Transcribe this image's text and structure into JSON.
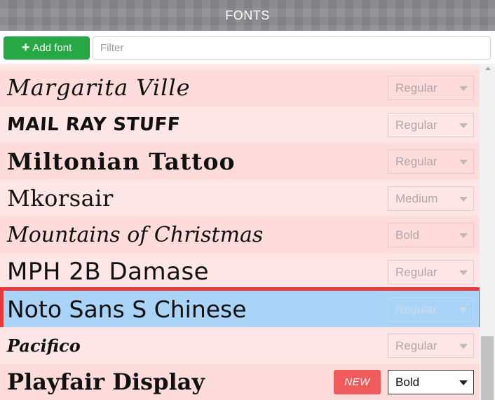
{
  "header": {
    "title": "FONTS"
  },
  "toolbar": {
    "add_label": "Add font",
    "add_icon": "plus-icon",
    "filter_placeholder": "Filter",
    "filter_value": ""
  },
  "fonts": [
    {
      "name": "Margarita Ville",
      "weight": "Regular"
    },
    {
      "name": "MAIL RAY STUFF",
      "weight": "Regular"
    },
    {
      "name": "Miltonian Tattoo",
      "weight": "Regular"
    },
    {
      "name": "Mkorsair",
      "weight": "Medium"
    },
    {
      "name": "Mountains of Christmas",
      "weight": "Bold"
    },
    {
      "name": "MPH 2B Damase",
      "weight": "Regular"
    },
    {
      "name": "Noto Sans S Chinese",
      "weight": "Regular",
      "selected": true
    },
    {
      "name": "Pacifico",
      "weight": "Regular"
    },
    {
      "name": "Playfair Display",
      "weight": "Bold",
      "badge": "NEW"
    }
  ],
  "colors": {
    "accent_green": "#27a844",
    "row_pink": "#ffdcdc",
    "row_pink_light": "#ffe6e6",
    "selected_blue": "#a9d4f7",
    "highlight_red": "#e8373b",
    "badge_red": "#f05b5b"
  }
}
